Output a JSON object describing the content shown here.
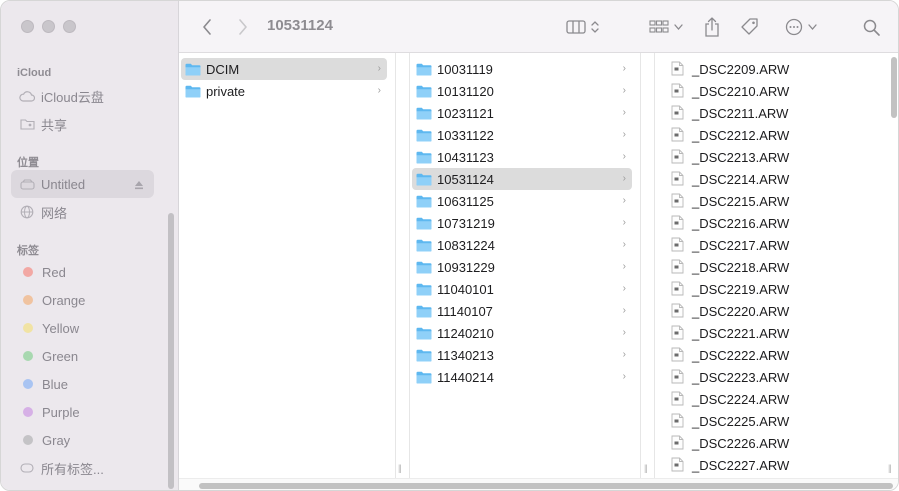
{
  "toolbar": {
    "title": "10531124"
  },
  "sidebar": {
    "icloud_header": "iCloud",
    "icloud_items": [
      {
        "label": "iCloud云盘",
        "icon": "cloud-icon"
      },
      {
        "label": "共享",
        "icon": "shared-folder-icon"
      }
    ],
    "locations_header": "位置",
    "location_items": [
      {
        "label": "Untitled",
        "icon": "drive-icon",
        "selected": true
      },
      {
        "label": "网络",
        "icon": "network-globe-icon"
      }
    ],
    "tags_header": "标签",
    "tags": [
      {
        "label": "Red",
        "color": "#f2a8a4"
      },
      {
        "label": "Orange",
        "color": "#f0c3a0"
      },
      {
        "label": "Yellow",
        "color": "#f1e3a4"
      },
      {
        "label": "Green",
        "color": "#a8d8b0"
      },
      {
        "label": "Blue",
        "color": "#a9c4f2"
      },
      {
        "label": "Purple",
        "color": "#d6b0e6"
      },
      {
        "label": "Gray",
        "color": "#c4c3c6"
      }
    ],
    "all_tags": "所有标签..."
  },
  "column1": [
    {
      "name": "DCIM",
      "selected": true
    },
    {
      "name": "private",
      "selected": false
    }
  ],
  "column2": [
    {
      "name": "10031119"
    },
    {
      "name": "10131120"
    },
    {
      "name": "10231121"
    },
    {
      "name": "10331122"
    },
    {
      "name": "10431123"
    },
    {
      "name": "10531124",
      "selected": true
    },
    {
      "name": "10631125"
    },
    {
      "name": "10731219"
    },
    {
      "name": "10831224"
    },
    {
      "name": "10931229"
    },
    {
      "name": "11040101"
    },
    {
      "name": "11140107"
    },
    {
      "name": "11240210"
    },
    {
      "name": "11340213"
    },
    {
      "name": "11440214"
    }
  ],
  "column3": [
    "_DSC2209.ARW",
    "_DSC2210.ARW",
    "_DSC2211.ARW",
    "_DSC2212.ARW",
    "_DSC2213.ARW",
    "_DSC2214.ARW",
    "_DSC2215.ARW",
    "_DSC2216.ARW",
    "_DSC2217.ARW",
    "_DSC2218.ARW",
    "_DSC2219.ARW",
    "_DSC2220.ARW",
    "_DSC2221.ARW",
    "_DSC2222.ARW",
    "_DSC2223.ARW",
    "_DSC2224.ARW",
    "_DSC2225.ARW",
    "_DSC2226.ARW",
    "_DSC2227.ARW"
  ],
  "colors": {
    "folder_blue": "#5eb8f0",
    "folder_blue_light": "#8fd0f8",
    "selection_gray": "#dcdcdc"
  }
}
